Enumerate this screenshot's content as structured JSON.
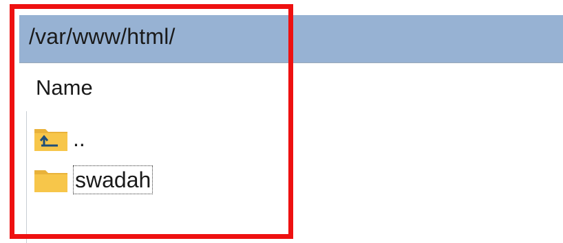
{
  "path_bar": {
    "path": "/var/www/html/"
  },
  "file_list": {
    "column_header": "Name",
    "items": [
      {
        "label": "..",
        "icon": "folder-up-icon"
      },
      {
        "label": "swadah",
        "icon": "folder-icon"
      }
    ]
  },
  "colors": {
    "path_bar_bg": "#97b2d3",
    "highlight": "#ee1111",
    "folder_yellow": "#f7c64a"
  }
}
